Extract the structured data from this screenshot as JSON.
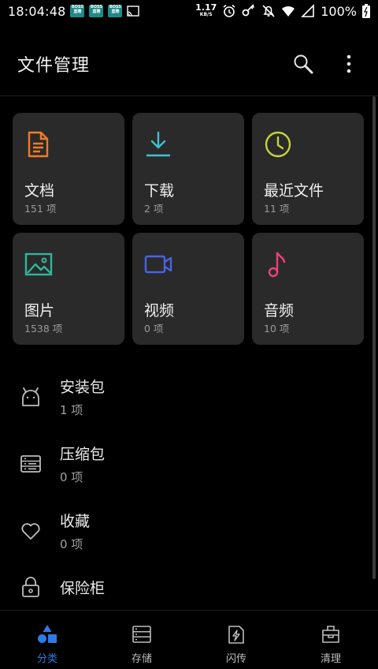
{
  "status_bar": {
    "time": "18:04:48",
    "badges": [
      "BOSS直聘",
      "BOSS直聘",
      "BOSS直聘"
    ],
    "net_speed_value": "1.17",
    "net_speed_unit": "KB/S",
    "battery_text": "100%",
    "icons": [
      "cast-icon",
      "alarm-icon",
      "key-icon",
      "mute-icon",
      "wifi-icon",
      "signal-icon",
      "battery-icon"
    ]
  },
  "header": {
    "title": "文件管理",
    "search_icon": "search-icon",
    "more_icon": "more-vertical-icon"
  },
  "categories": [
    {
      "name": "文档",
      "count": "151 项",
      "icon": "document-icon",
      "color": "#f07a2c"
    },
    {
      "name": "下载",
      "count": "2 项",
      "icon": "download-icon",
      "color": "#3fc1d4"
    },
    {
      "name": "最近文件",
      "count": "11 项",
      "icon": "clock-icon",
      "color": "#c8d23a"
    },
    {
      "name": "图片",
      "count": "1538 项",
      "icon": "image-icon",
      "color": "#2fb79a"
    },
    {
      "name": "视频",
      "count": "0 项",
      "icon": "video-icon",
      "color": "#4b63e6"
    },
    {
      "name": "音频",
      "count": "10 项",
      "icon": "music-icon",
      "color": "#f0407a"
    }
  ],
  "list": [
    {
      "name": "安装包",
      "count": "1 项",
      "icon": "android-icon"
    },
    {
      "name": "压缩包",
      "count": "0 项",
      "icon": "archive-icon"
    },
    {
      "name": "收藏",
      "count": "0 项",
      "icon": "heart-icon"
    },
    {
      "name": "保险柜",
      "icon": "lock-icon"
    }
  ],
  "bottom_nav": [
    {
      "label": "分类",
      "icon": "category-icon",
      "active": true
    },
    {
      "label": "存储",
      "icon": "storage-icon",
      "active": false
    },
    {
      "label": "闪传",
      "icon": "flash-transfer-icon",
      "active": false
    },
    {
      "label": "清理",
      "icon": "cleanup-icon",
      "active": false
    }
  ],
  "colors": {
    "accent": "#2f7ae5",
    "background": "#000000",
    "tile": "#2a2a2a"
  }
}
